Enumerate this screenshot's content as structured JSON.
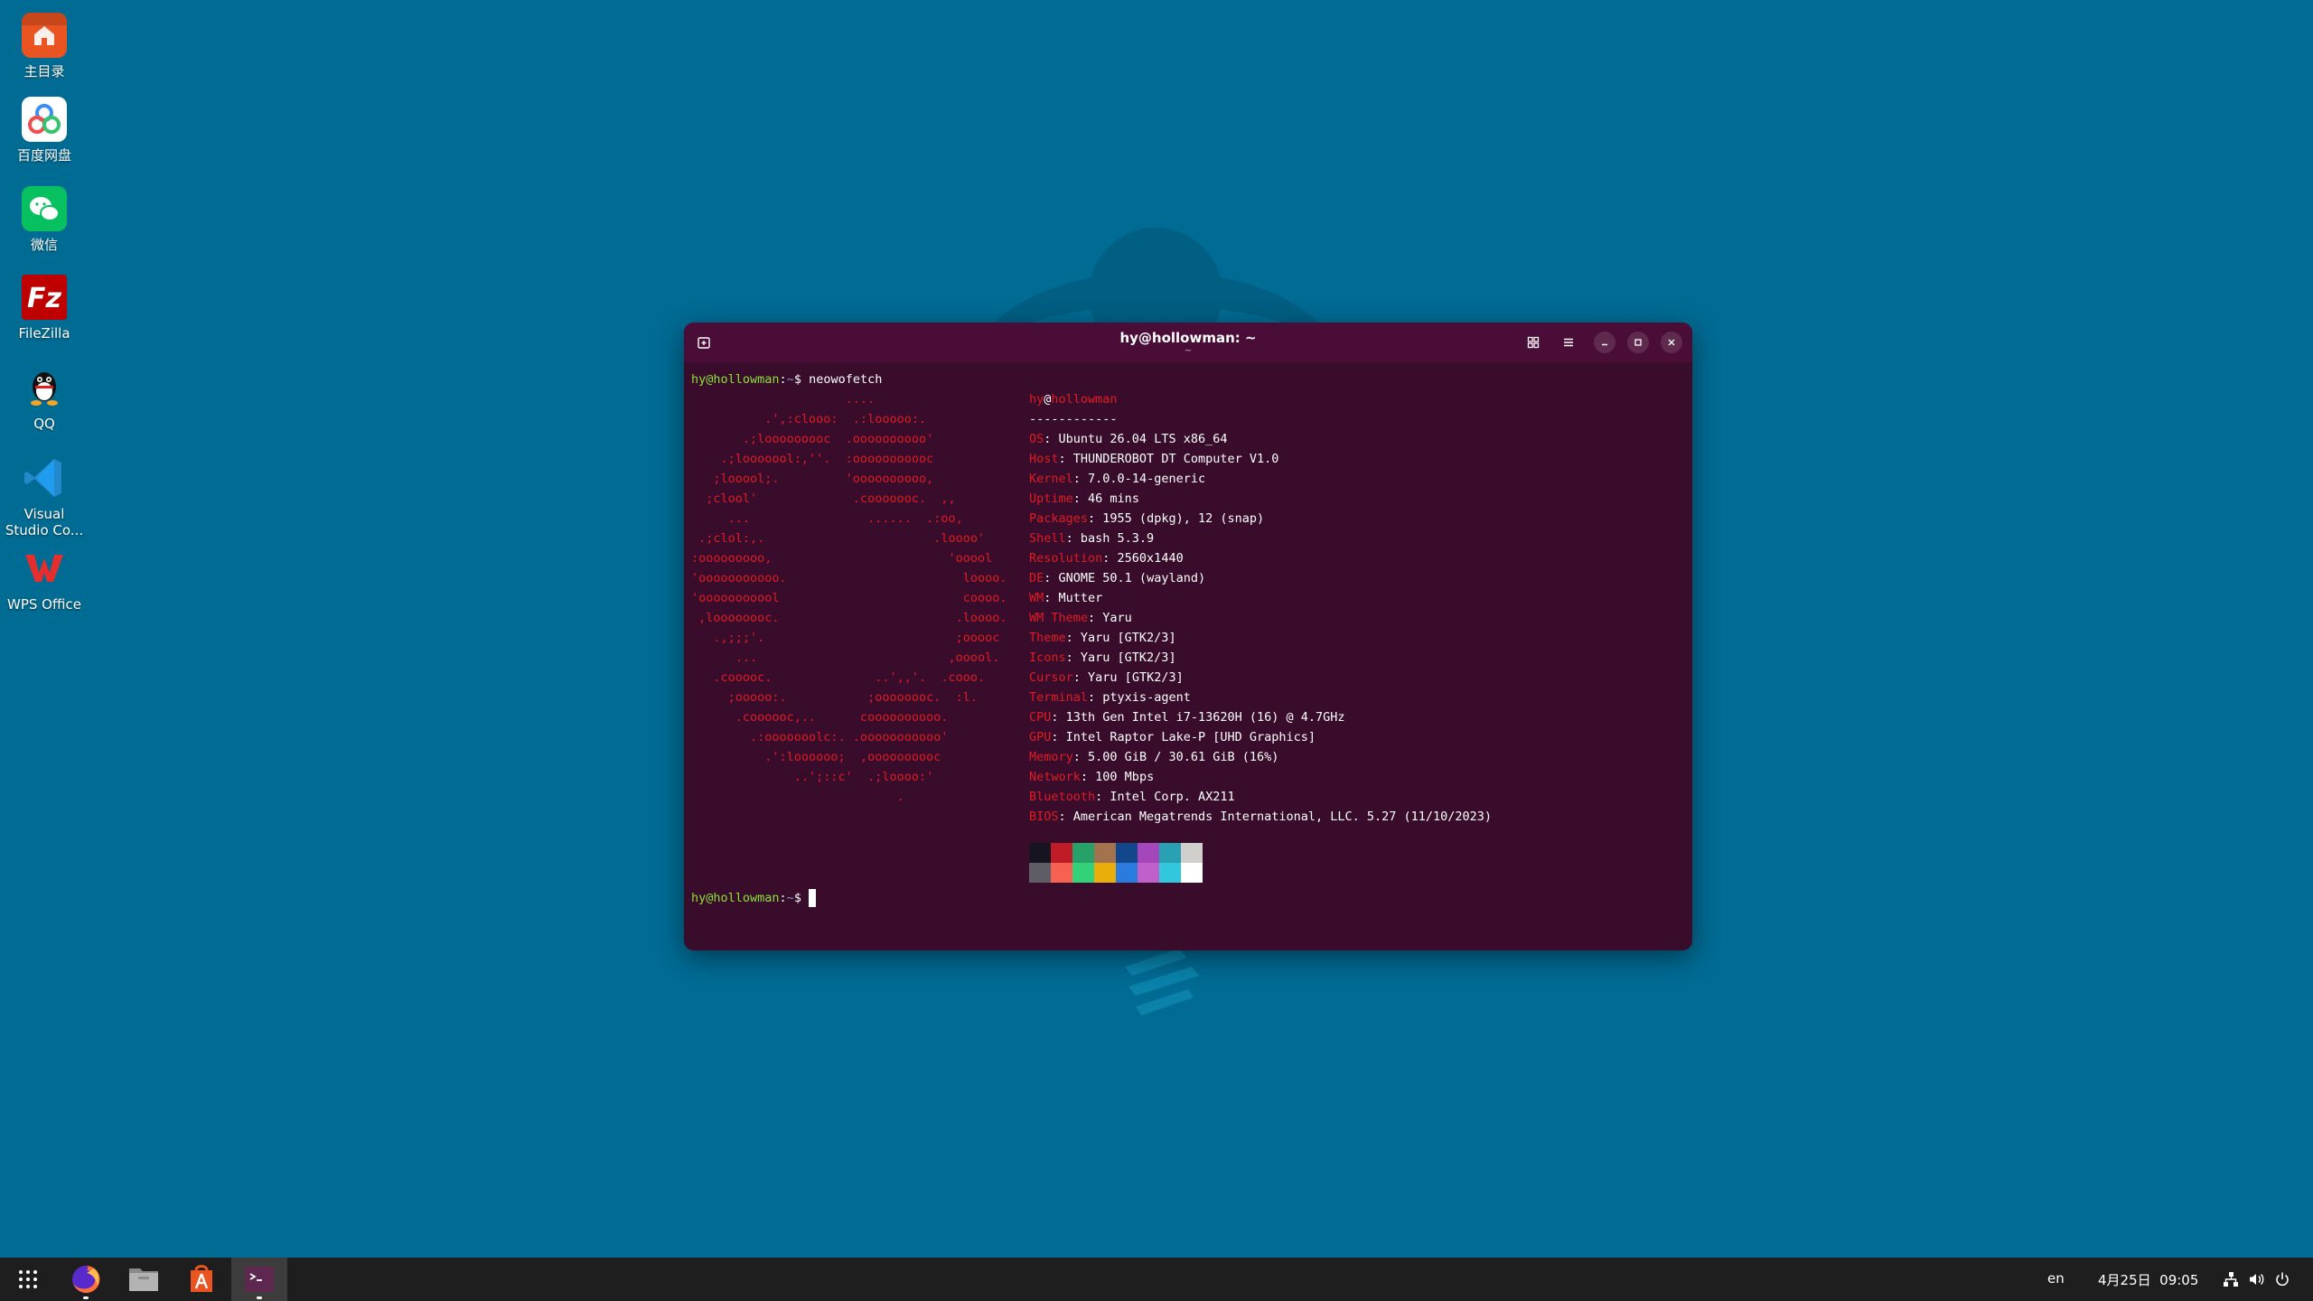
{
  "desktop": {
    "icons": [
      {
        "label": "主目录",
        "icon": "home-folder-icon"
      },
      {
        "label": "百度网盘",
        "icon": "baidu-netdisk-icon"
      },
      {
        "label": "微信",
        "icon": "wechat-icon"
      },
      {
        "label": "FileZilla",
        "icon": "filezilla-icon"
      },
      {
        "label": "QQ",
        "icon": "qq-icon"
      },
      {
        "label": "Visual Studio Co...",
        "icon": "vscode-icon"
      },
      {
        "label": "WPS Office",
        "icon": "wps-office-icon"
      }
    ]
  },
  "terminal": {
    "title": "hy@hollowman: ~",
    "subtitle": "~",
    "prompt": {
      "user": "hy@hollowman",
      "path": "~",
      "sign": "$"
    },
    "command": "neowofetch",
    "ascii_art": "                     ....\n          .',:clooo:  .:looooo:.\n       .;looooooooc  .oooooooooo'\n    .;looooool:,''.  :ooooooooooc\n   ;looool;.         'oooooooooo,\n  ;clool'             .cooooooc.  ,,\n     ...                ......  .:oo,\n .;clol:,.                       .loooo'\n:ooooooooo,                        'ooool\n'ooooooooooo.                        loooo.\n'ooooooooool                         coooo.\n ,loooooooc.                        .loooo.\n   .,;;;'.                          ;ooooc\n      ...                          ,ooool.\n   .cooooc.              ..',,'.  .cooo.\n     ;ooooo:.           ;oooooooc.  :l.\n      .coooooc,..      coooooooooo.\n        .:ooooooolc:. .ooooooooooo'\n          .':loooooo;  ,oooooooooc\n              ..';::c'  .;loooo:'\n                            .",
    "info_header": {
      "user": "hy",
      "at": "@",
      "host": "hollowman",
      "sep": "------------"
    },
    "info": [
      {
        "k": "OS",
        "v": "Ubuntu 26.04 LTS x86_64"
      },
      {
        "k": "Host",
        "v": "THUNDEROBOT DT Computer V1.0"
      },
      {
        "k": "Kernel",
        "v": "7.0.0-14-generic"
      },
      {
        "k": "Uptime",
        "v": "46 mins"
      },
      {
        "k": "Packages",
        "v": "1955 (dpkg), 12 (snap)"
      },
      {
        "k": "Shell",
        "v": "bash 5.3.9"
      },
      {
        "k": "Resolution",
        "v": "2560x1440"
      },
      {
        "k": "DE",
        "v": "GNOME 50.1 (wayland)"
      },
      {
        "k": "WM",
        "v": "Mutter"
      },
      {
        "k": "WM Theme",
        "v": "Yaru"
      },
      {
        "k": "Theme",
        "v": "Yaru [GTK2/3]"
      },
      {
        "k": "Icons",
        "v": "Yaru [GTK2/3]"
      },
      {
        "k": "Cursor",
        "v": "Yaru [GTK2/3]"
      },
      {
        "k": "Terminal",
        "v": "ptyxis-agent"
      },
      {
        "k": "CPU",
        "v": "13th Gen Intel i7-13620H (16) @ 4.7GHz"
      },
      {
        "k": "GPU",
        "v": "Intel Raptor Lake-P [UHD Graphics]"
      },
      {
        "k": "Memory",
        "v": "5.00 GiB / 30.61 GiB (16%)"
      },
      {
        "k": "Network",
        "v": "100 Mbps"
      },
      {
        "k": "Bluetooth",
        "v": "Intel Corp. AX211"
      },
      {
        "k": "BIOS",
        "v": "American Megatrends International, LLC. 5.27 (11/10/2023)"
      }
    ],
    "palette": [
      "#171421",
      "#c01c28",
      "#26a269",
      "#a2734c",
      "#12488b",
      "#a347ba",
      "#2aa1b3",
      "#d0cfcc",
      "#5e5c64",
      "#f66151",
      "#33d17a",
      "#e9ad0c",
      "#2a7bde",
      "#c061cb",
      "#33c7de",
      "#ffffff"
    ]
  },
  "taskbar": {
    "apps": [
      {
        "name": "apps-grid-icon"
      },
      {
        "name": "firefox-icon"
      },
      {
        "name": "files-icon"
      },
      {
        "name": "app-center-icon"
      },
      {
        "name": "terminal-icon"
      }
    ],
    "language": "en",
    "clock": "4月25日  09:05"
  }
}
